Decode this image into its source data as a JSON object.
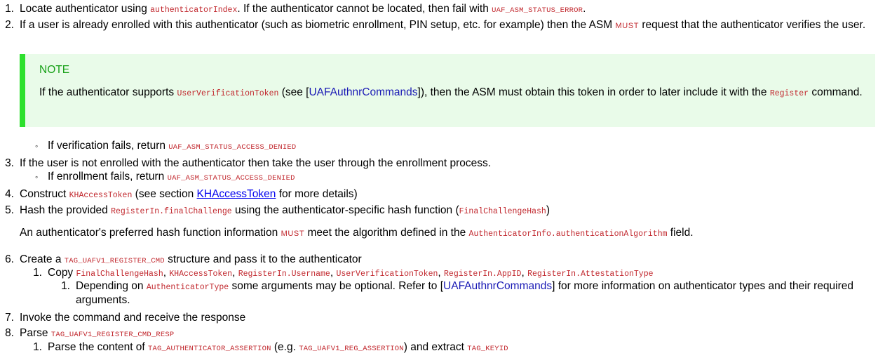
{
  "step1": {
    "num": "1.",
    "t1": "Locate authenticator using ",
    "c1": "authenticatorIndex",
    "t2": ". If the authenticator cannot be located, then fail with ",
    "c2": "UAF_ASM_STATUS_ERROR",
    "t3": "."
  },
  "step2": {
    "num": "2.",
    "t1": "If a user is already enrolled with this authenticator (such as biometric enrollment, PIN setup, etc. for example) then the ASM ",
    "must": "must",
    "t2": " request that the authenticator verifies the user."
  },
  "note": {
    "title": "NOTE",
    "t1": "If the authenticator supports ",
    "c1": "UserVerificationToken",
    "t2": " (see [",
    "ref": "UAFAuthnrCommands",
    "t3": "]), then the ASM must obtain this token in order to later include it with the ",
    "c2": "Register",
    "t4": " command."
  },
  "step2_sub": {
    "bullet": "◦",
    "t1": "If verification fails, return ",
    "c1": "UAF_ASM_STATUS_ACCESS_DENIED"
  },
  "step3": {
    "num": "3.",
    "t1": "If the user is not enrolled with the authenticator then take the user through the enrollment process.",
    "sub_bullet": "◦",
    "sub_t1": "If enrollment fails, return ",
    "sub_c1": "UAF_ASM_STATUS_ACCESS_DENIED"
  },
  "step4": {
    "num": "4.",
    "t1": "Construct ",
    "c1": "KHAccessToken",
    "t2": " (see section ",
    "link": "KHAccessToken",
    "t3": " for more details)"
  },
  "step5": {
    "num": "5.",
    "t1": "Hash the provided ",
    "c1": "RegisterIn.finalChallenge",
    "t2": " using the authenticator-specific hash function (",
    "c2": "FinalChallengeHash",
    "t3": ")",
    "p1": "An authenticator's preferred hash function information ",
    "must": "must",
    "p2": " meet the algorithm defined in the ",
    "pc1": "AuthenticatorInfo.authenticationAlgorithm",
    "p3": " field."
  },
  "step6": {
    "num": "6.",
    "t1": "Create a ",
    "c1": "TAG_UAFV1_REGISTER_CMD",
    "t2": " structure and pass it to the authenticator",
    "sub_num": "1.",
    "sub_t1": "Copy ",
    "sub_c1": "FinalChallengeHash",
    "sub_sep1": ", ",
    "sub_c2": "KHAccessToken",
    "sub_sep2": ", ",
    "sub_c3": "RegisterIn.Username",
    "sub_sep3": ", ",
    "sub_c4": "UserVerificationToken",
    "sub_sep4": ", ",
    "sub_c5": "RegisterIn.AppID",
    "sub_sep5": ", ",
    "sub_c6": "RegisterIn.AttestationType",
    "subsub_num": "1.",
    "subsub_t1": "Depending on ",
    "subsub_c1": "AuthenticatorType",
    "subsub_t2": " some arguments may be optional. Refer to [",
    "subsub_ref": "UAFAuthnrCommands",
    "subsub_t3": "] for more information on authenticator types and their required arguments."
  },
  "step7": {
    "num": "7.",
    "t1": "Invoke the command and receive the response"
  },
  "step8": {
    "num": "8.",
    "t1": "Parse ",
    "c1": "TAG_UAFV1_REGISTER_CMD_RESP",
    "sub_num": "1.",
    "sub_t1": "Parse the content of ",
    "sub_c1": "TAG_AUTHENTICATOR_ASSERTION",
    "sub_t2": " (e.g. ",
    "sub_c2": "TAG_UAFV1_REG_ASSERTION",
    "sub_t3": ") and extract ",
    "sub_c3": "TAG_KEYID"
  }
}
